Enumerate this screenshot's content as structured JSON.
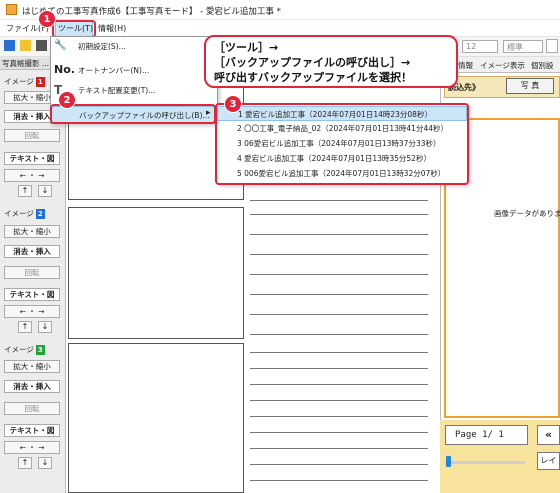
{
  "title": "はじめての工事写真作成6【工事写真モード】 - 愛宕ビル追加工事 *",
  "menu": {
    "file": "ファイル(F)",
    "tool": "ツール(T)",
    "info": "情報(H)"
  },
  "toolbar": {
    "select1": "12",
    "select2": "標準"
  },
  "left": {
    "header": "写真帳撮影 ...",
    "images": [
      {
        "label": "イメージ",
        "num": "1",
        "color": "#d81b1b"
      },
      {
        "label": "イメージ",
        "num": "2",
        "color": "#1e6fd9"
      },
      {
        "label": "イメージ",
        "num": "3",
        "color": "#22a33a"
      }
    ],
    "btn_zoom": "拡大・縮小",
    "btn_erase": "消去・挿入",
    "btn_rotate": "回転",
    "btn_text": "テキスト・図",
    "arrow_lr": "← ・ →",
    "arrow_up": "↑",
    "arrow_down": "↓"
  },
  "dropdown": {
    "items": [
      {
        "label": "初期設定(S)...",
        "icon": "wrench-icon"
      },
      {
        "label": "オートナンバー(N)...",
        "icon": "number-icon"
      },
      {
        "label": "テキスト配置変更(T)...",
        "icon": "text-layout-icon"
      },
      {
        "label": "バックアップファイルの呼び出し(B)...",
        "icon": ""
      }
    ],
    "arrow": "▸"
  },
  "submenu": {
    "items": [
      "1 愛宕ビル追加工事（2024年07月01日14時23分08秒）",
      "2 〇〇工事_電子納品_02（2024年07月01日13時41分44秒）",
      "3 06愛宕ビル追加工事（2024年07月01日13時37分33秒）",
      "4 愛宕ビル追加工事（2024年07月01日13時35分52秒）",
      "5 006愛宕ビル追加工事（2024年07月01日13時32分07秒）"
    ]
  },
  "callout": {
    "line1": "［ツール］→",
    "line2": "［バックアップファイルの呼び出し］→",
    "line3": "呼び出すバックアップファイルを選択！"
  },
  "steps": [
    "1",
    "2",
    "3"
  ],
  "right": {
    "tab1": "情報",
    "tab2": "イメージ表示",
    "tab3": "個別設",
    "box_label": "読込先》",
    "photo_btn": "写 真",
    "no_image": "画像データがありま",
    "page": "Page  1/  1",
    "prev": "«",
    "layout_btn": "レイ"
  },
  "colors": {
    "accent_red": "#e4243a",
    "highlight_blue": "#cde6f7",
    "orange": "#f2a12a",
    "yellow": "#f7e39c"
  }
}
